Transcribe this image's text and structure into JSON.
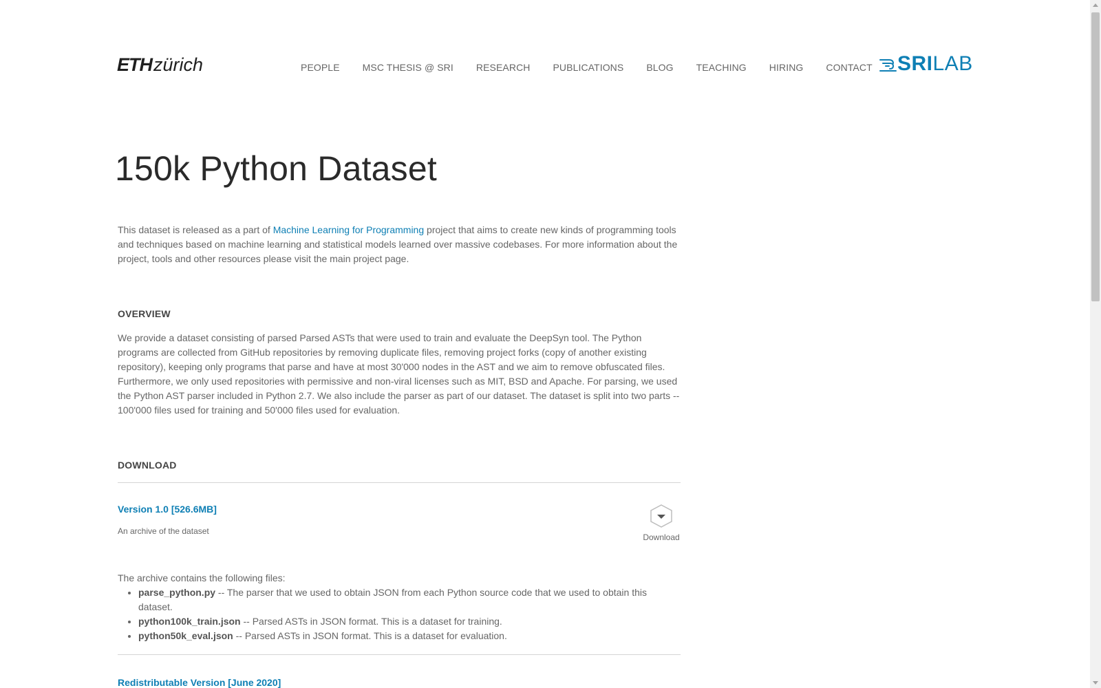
{
  "header": {
    "eth_logo": {
      "bold": "ETH",
      "light": "zürich"
    },
    "nav": [
      {
        "label": "PEOPLE"
      },
      {
        "label": "MSC THESIS @ SRI"
      },
      {
        "label": "RESEARCH"
      },
      {
        "label": "PUBLICATIONS"
      },
      {
        "label": "BLOG"
      },
      {
        "label": "TEACHING"
      },
      {
        "label": "HIRING"
      },
      {
        "label": "CONTACT"
      }
    ],
    "sri_logo": {
      "bold": "SRI",
      "light": "LAB",
      "icon": "wind-lines-icon",
      "color": "#0e7fb4"
    }
  },
  "main": {
    "title": "150k Python Dataset",
    "intro": {
      "before": "This dataset is released as a part of ",
      "link": "Machine Learning for Programming",
      "after": " project that aims to create new kinds of programming tools and techniques based on machine learning and statistical models learned over massive codebases. For more information about the project, tools and other resources please visit the main project page."
    },
    "overview": {
      "heading": "OVERVIEW",
      "text": "We provide a dataset consisting of parsed Parsed ASTs that were used to train and evaluate the DeepSyn tool. The Python programs are collected from GitHub repositories by removing duplicate files, removing project forks (copy of another existing repository), keeping only programs that parse and have at most 30'000 nodes in the AST and we aim to remove obfuscated files. Furthermore, we only used repositories with permissive and non-viral licenses such as MIT, BSD and Apache. For parsing, we used the Python AST parser included in Python 2.7. We also include the parser as part of our dataset. The dataset is split into two parts -- 100'000 files used for training and 50'000 files used for evaluation."
    },
    "download": {
      "heading": "DOWNLOAD",
      "version": {
        "label": "Version 1.0 [526.6MB]",
        "description": "An archive of the dataset",
        "button_label": "Download",
        "icon": "download-chevron-icon"
      },
      "files_intro": "The archive contains the following files:",
      "files": [
        {
          "name": "parse_python.py",
          "desc": " -- The parser that we used to obtain JSON from each Python source code that we used to obtain this dataset."
        },
        {
          "name": "python100k_train.json",
          "desc": " -- Parsed ASTs in JSON format. This is a dataset for training."
        },
        {
          "name": "python50k_eval.json",
          "desc": " -- Parsed ASTs in JSON format. This is a dataset for evaluation."
        }
      ],
      "redistributable": {
        "label": "Redistributable Version [June 2020]"
      }
    }
  },
  "colors": {
    "accent": "#0e7fb4",
    "text": "#666666",
    "heading": "#2a2a2a"
  }
}
